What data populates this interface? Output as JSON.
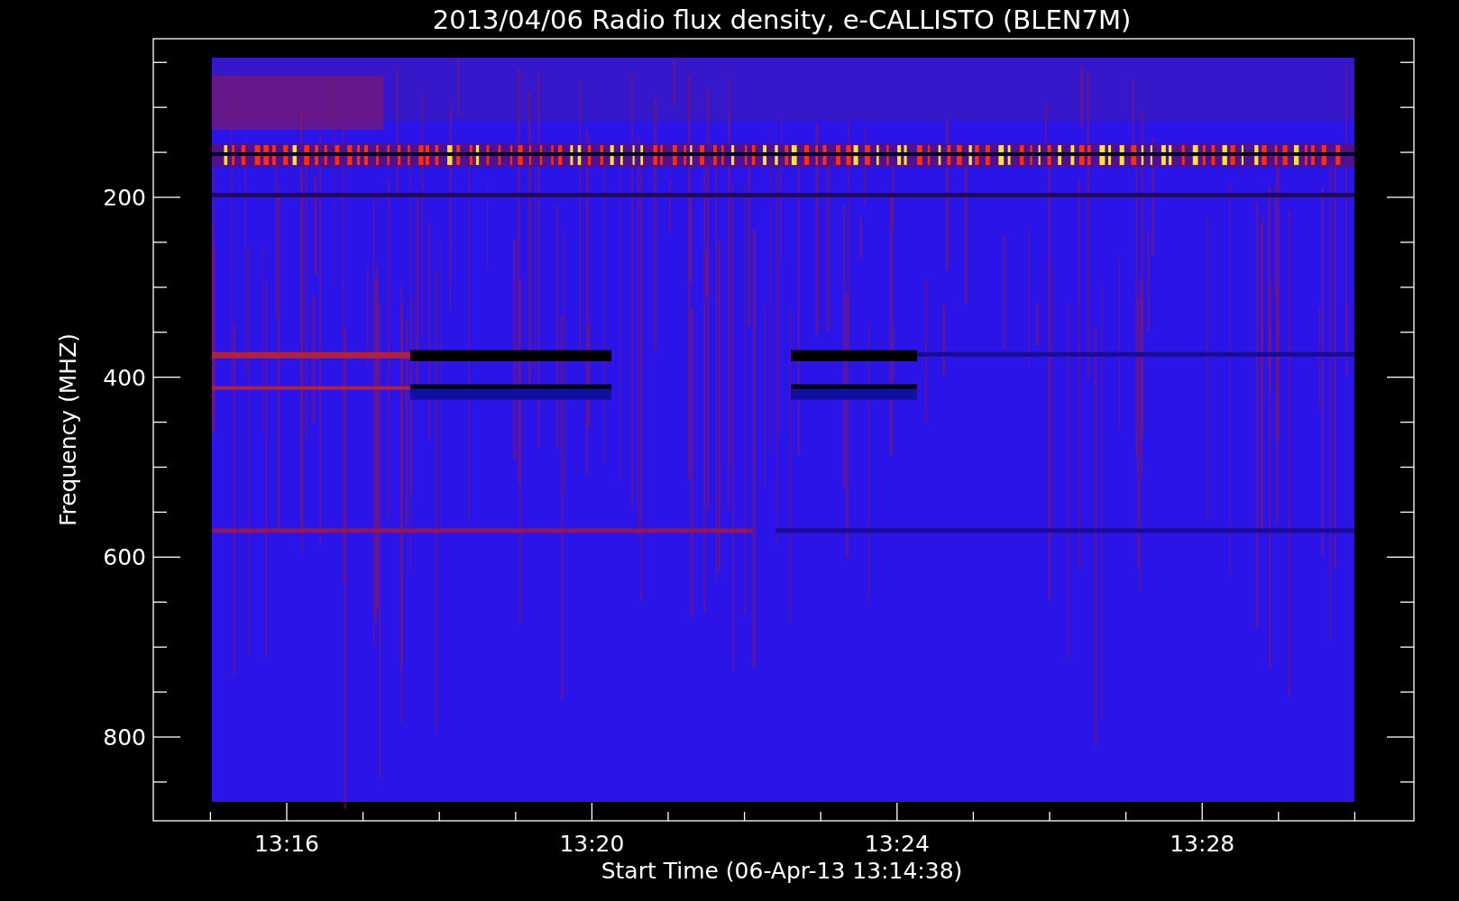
{
  "title": "2013/04/06  Radio flux density, e-CALLISTO (BLEN7M)",
  "y_axis": {
    "label": "Frequency (MHZ)",
    "ticks": [
      "200",
      "400",
      "600",
      "800"
    ]
  },
  "x_axis": {
    "label": "Start Time (06-Apr-13 13:14:38)",
    "ticks": [
      "13:16",
      "13:20",
      "13:24",
      "13:28"
    ]
  }
}
